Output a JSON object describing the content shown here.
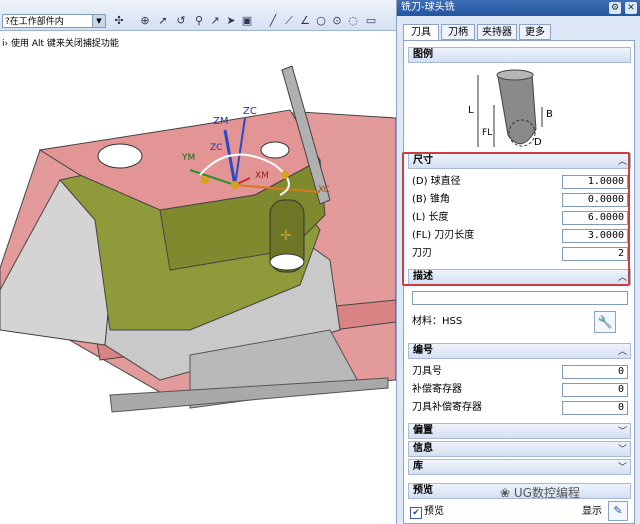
{
  "toolbar": {
    "selection_filter": "?在工作部件内",
    "hint": "i› 使用 Alt 键来关闭捕捉功能"
  },
  "axes": {
    "zm": "ZM",
    "zc": "ZC",
    "ym": "YM",
    "xm": "XM",
    "xc": "XC",
    "zc_small": "ZC"
  },
  "dialog": {
    "title": "铣刀-球头铣",
    "tabs": [
      "刀具",
      "刀柄",
      "夹持器",
      "更多"
    ],
    "legend": {
      "header": "图例",
      "labels": {
        "L": "L",
        "FL": "FL",
        "B": "B",
        "D": "D"
      }
    },
    "dimensions": {
      "header": "尺寸",
      "fields": [
        {
          "label": "(D) 球直径",
          "value": "1.0000"
        },
        {
          "label": "(B) 锥角",
          "value": "0.0000"
        },
        {
          "label": "(L) 长度",
          "value": "6.0000"
        },
        {
          "label": "(FL) 刀刃长度",
          "value": "3.0000"
        },
        {
          "label": "刀刃",
          "value": "2"
        }
      ]
    },
    "description": {
      "header": "描述",
      "value": "",
      "material": "材料：HSS"
    },
    "numbering": {
      "header": "编号",
      "fields": [
        {
          "label": "刀具号",
          "value": "0"
        },
        {
          "label": "补偿寄存器",
          "value": "0"
        },
        {
          "label": "刀具补偿寄存器",
          "value": "0"
        }
      ]
    },
    "collapsed_sections": [
      "偏置",
      "信息",
      "库"
    ],
    "preview": {
      "header": "预览",
      "checkbox_label": "预览",
      "show_label": "显示"
    }
  },
  "watermark": "UG数控编程",
  "colors": {
    "highlight": "#d03b3b",
    "pink_face": "#e39494",
    "olive_face": "#8f9a3a",
    "gray_side": "#cfcfcf"
  }
}
